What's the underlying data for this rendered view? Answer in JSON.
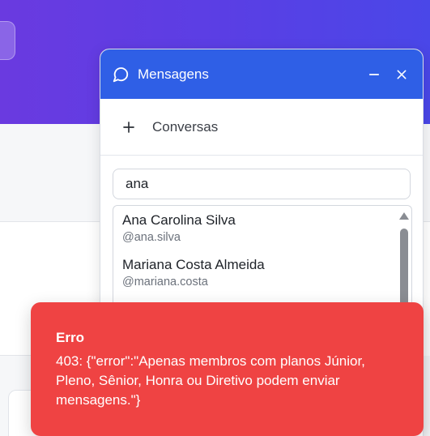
{
  "chat": {
    "title": "Mensagens",
    "new_conversation_label": "Conversas",
    "search": {
      "value": "ana"
    },
    "results": [
      {
        "name": "Ana Carolina Silva",
        "handle": "@ana.silva"
      },
      {
        "name": "Mariana Costa Almeida",
        "handle": "@mariana.costa"
      }
    ]
  },
  "toast": {
    "title": "Erro",
    "message": "403: {\"error\":\"Apenas membros com planos Júnior, Pleno, Sênior, Honra ou Diretivo podem enviar mensagens.\"}"
  },
  "colors": {
    "header_gradient_start": "#6a3ae0",
    "header_gradient_end": "#4a47e8",
    "chat_header": "#2f5fe6",
    "error_toast": "#ef4343"
  },
  "icons": {
    "chat": "chat-bubble-icon",
    "minimize": "minimize-icon",
    "close": "close-icon",
    "new_conversation": "plus-icon",
    "scroll_up": "scroll-up-arrow-icon"
  }
}
